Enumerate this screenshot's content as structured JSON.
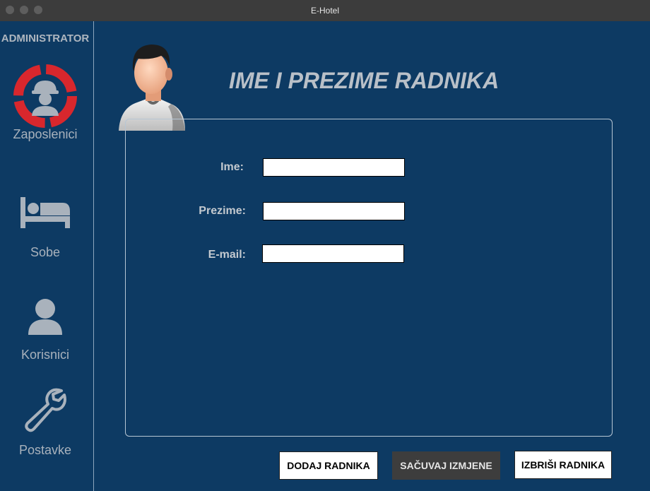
{
  "window": {
    "title": "E-Hotel"
  },
  "sidebar": {
    "role_label": "ADMINISTRATOR",
    "items": [
      {
        "label": "Zaposlenici",
        "icon": "worker-icon"
      },
      {
        "label": "Sobe",
        "icon": "bed-icon"
      },
      {
        "label": "Korisnici",
        "icon": "user-icon"
      },
      {
        "label": "Postavke",
        "icon": "wrench-icon"
      }
    ]
  },
  "main": {
    "header_title": "IME I PREZIME RADNIKA",
    "form": {
      "fields": [
        {
          "label": "Ime:",
          "value": "",
          "placeholder": ""
        },
        {
          "label": "Prezime:",
          "value": "",
          "placeholder": ""
        },
        {
          "label": "E-mail:",
          "value": "",
          "placeholder": ""
        }
      ]
    },
    "buttons": {
      "add": "DODAJ RADNIKA",
      "save": "SAČUVAJ IZMJENE",
      "delete": "IZBRIŠI RADNIKA"
    }
  },
  "colors": {
    "background": "#0d3a63",
    "accent_red": "#d8272d",
    "icon_gray": "#a9b2bc",
    "titlebar": "#3c3c3c"
  }
}
